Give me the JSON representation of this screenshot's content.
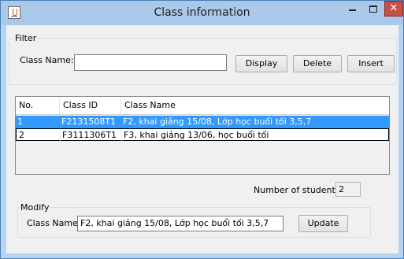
{
  "window": {
    "title": "Class information",
    "close_glyph": "✕"
  },
  "filter": {
    "legend": "Filter",
    "class_name_label": "Class Name:",
    "class_name_value": "",
    "display_label": "Display",
    "delete_label": "Delete",
    "insert_label": "Insert"
  },
  "table": {
    "columns": [
      "No.",
      "Class ID",
      "Class Name"
    ],
    "rows": [
      [
        "1",
        "F2131508T1",
        "F2, khai giảng 15/08, Lớp học buổi tối 3,5,7"
      ],
      [
        "2",
        "F3111306T1",
        "F3, khai giảng 13/06, học buổi tối"
      ]
    ],
    "selected_row": 0
  },
  "students": {
    "label": "Number of students:",
    "value": "2"
  },
  "modify": {
    "legend": "Modify",
    "class_name_label": "Class Name:",
    "class_name_value": "F2, khai giảng 15/08, Lớp học buổi tối 3,5,7",
    "update_label": "Update"
  },
  "colors": {
    "selection": "#3399ff",
    "titlebar": "#aac8e8",
    "close": "#c7514a"
  }
}
